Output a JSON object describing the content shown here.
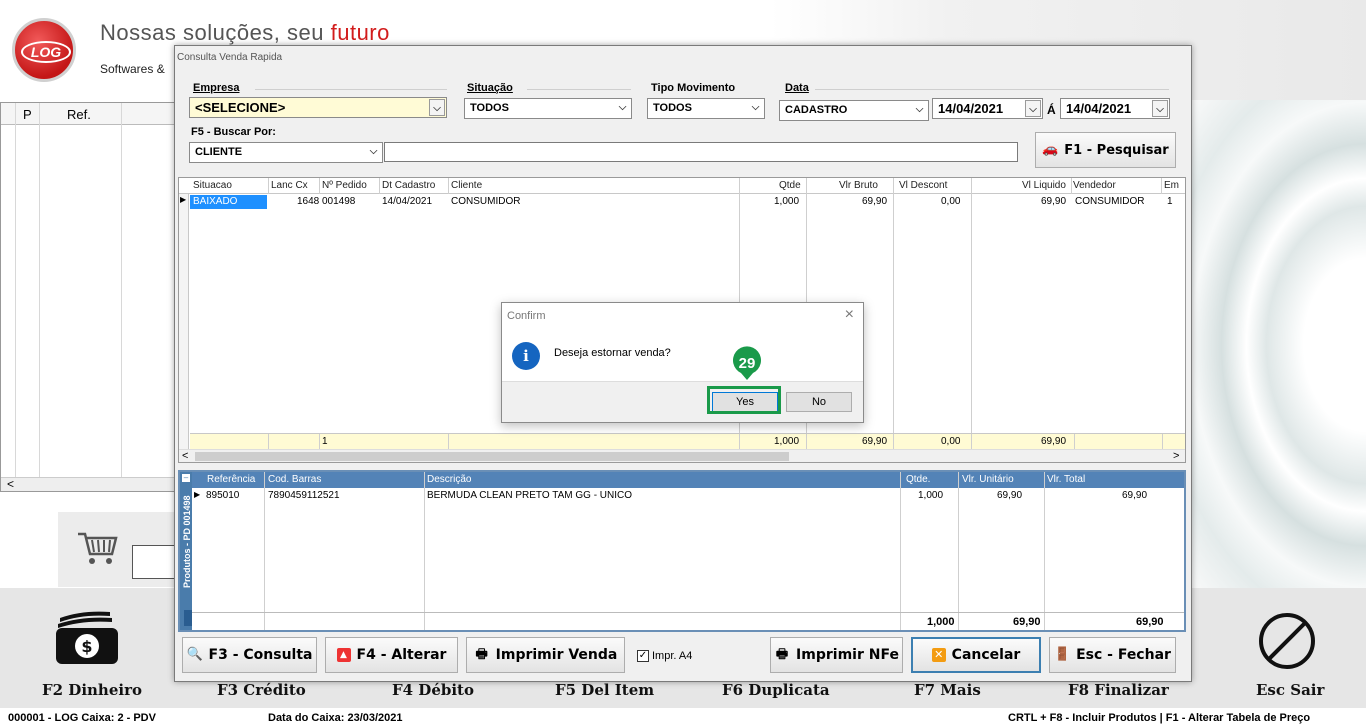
{
  "header": {
    "logo_text": "LOG",
    "slogan_part1": "Nossas soluções, seu ",
    "slogan_highlight": "futuro",
    "slogan_sub": "Softwares &"
  },
  "bg_grid": {
    "col_p": "P",
    "col_ref": "Ref.",
    "scroll_left": "<"
  },
  "dialog": {
    "title": "Consulta Venda Rapida",
    "empresa_label": "Empresa",
    "empresa_value": "<SELECIONE>",
    "situacao_label": "Situação",
    "situacao_value": "TODOS",
    "tipo_label": "Tipo Movimento",
    "tipo_value": "TODOS",
    "data_label": "Data",
    "data_type_value": "CADASTRO",
    "data_from": "14/04/2021",
    "data_sep": "Á",
    "data_to": "14/04/2021",
    "buscar_label": "F5 - Buscar Por:",
    "buscar_value": "CLIENTE",
    "buscar_text": "",
    "pesquisar_label": "F1 - Pesquisar"
  },
  "grid1": {
    "columns": [
      "Situacao",
      "Lanc Cx",
      "Nº Pedido",
      "Dt Cadastro",
      "Cliente",
      "Qtde",
      "Vlr Bruto",
      "Vl Descont",
      "Vl Liquido",
      "Vendedor",
      "Em"
    ],
    "row": {
      "situacao": "BAIXADO",
      "lanc_cx": "1648",
      "pedido": "001498",
      "dt_cadastro": "14/04/2021",
      "cliente": "CONSUMIDOR",
      "qtde": "1,000",
      "vlr_bruto": "69,90",
      "vl_descont": "0,00",
      "vl_liquido": "69,90",
      "vendedor": "CONSUMIDOR",
      "em": "1"
    },
    "totals": {
      "count": "1",
      "qtde": "1,000",
      "vlr_bruto": "69,90",
      "vl_descont": "0,00",
      "vl_liquido": "69,90"
    },
    "scroll_left": "<",
    "scroll_right": ">"
  },
  "grid2": {
    "side_label": "Produtos - PD 001498",
    "columns": [
      "Referência",
      "Cod. Barras",
      "Descrição",
      "Qtde.",
      "Vlr. Unitário",
      "Vlr. Total"
    ],
    "row": {
      "ref": "895010",
      "barras": "7890459112521",
      "descricao": "BERMUDA CLEAN PRETO TAM  GG - UNICO",
      "qtde": "1,000",
      "unit": "69,90",
      "total": "69,90"
    },
    "totals": {
      "qtde": "1,000",
      "unit": "69,90",
      "total": "69,90"
    }
  },
  "buttons": {
    "consulta": "F3 - Consulta",
    "alterar": "F4 - Alterar",
    "imprimir_venda": "Imprimir Venda",
    "impr_a4": "Impr. A4",
    "impr_a4_checked": "✓",
    "imprimir_nfe": "Imprimir NFe",
    "cancelar": "Cancelar",
    "fechar": "Esc - Fechar"
  },
  "confirm": {
    "title": "Confirm",
    "close": "×",
    "info": "i",
    "message": "Deseja estornar venda?",
    "yes": "Yes",
    "no": "No",
    "badge": "29"
  },
  "footer": {
    "f2": "F2 Dinheiro",
    "f3": "F3 Crédito",
    "f4": "F4 Débito",
    "f5": "F5 Del Item",
    "f6": "F6 Duplicata",
    "f7": "F7 Mais",
    "f8": "F8 Finalizar",
    "esc": "Esc Sair",
    "dollar": "$"
  },
  "status": {
    "left": "000001 - LOG   Caixa: 2 - PDV",
    "caixa_date": "Data do Caixa: 23/03/2021",
    "right": "CRTL + F8 - Incluir Produtos | F1 - Alterar Tabela de Preço"
  },
  "colors": {
    "accent_green": "#1a9a4a",
    "selection_blue": "#1e90ff",
    "grid2_header": "#5383b7"
  }
}
